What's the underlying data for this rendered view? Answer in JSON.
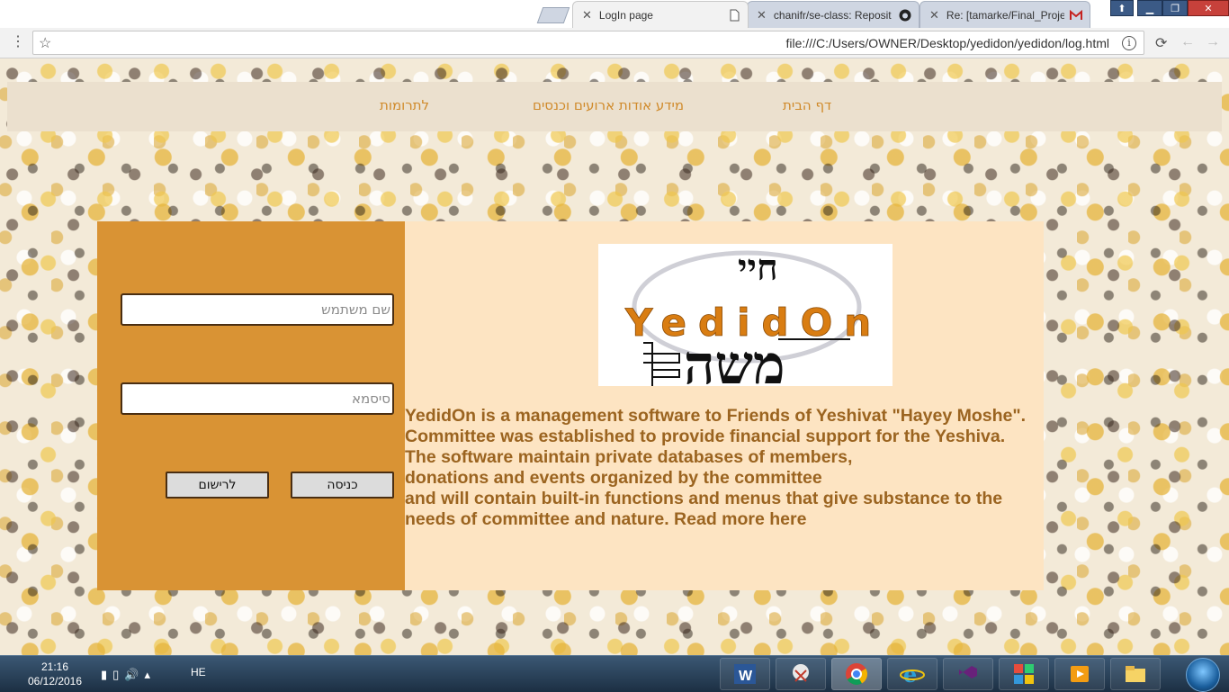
{
  "browser": {
    "tabs": [
      {
        "label": "LogIn page",
        "active": true
      },
      {
        "label": "chanifr/se-class: Reposit",
        "active": false
      },
      {
        "label": "Re: [tamarke/Final_Proje",
        "active": false
      }
    ],
    "url": "file:///C:/Users/OWNER/Desktop/yedidon/yedidon/log.html"
  },
  "nav": {
    "home": "דף הבית",
    "events": "מידע אודות ארועים וכנסים",
    "donations": "לתרומות"
  },
  "login": {
    "username_placeholder": "שם משתמש",
    "password_placeholder": "סיסמא",
    "login_label": "כניסה",
    "register_label": "לרישום"
  },
  "logo": {
    "name": "YedidOn",
    "hebrew_top": "חיי",
    "hebrew_bottom": "משה"
  },
  "description": [
    "YedidOn is a management software to Friends of Yeshivat \"Hayey Moshe\".",
    "Committee was established to provide financial support for the Yeshiva.",
    "The software maintain private databases of members,",
    "donations and events organized by the committee",
    "and will contain built-in functions and menus that give substance to the",
    "needs of committee and nature. Read more here"
  ],
  "taskbar": {
    "time": "21:16",
    "date": "06/12/2016",
    "language": "HE"
  },
  "colors": {
    "nav_bg": "#ebe0ce",
    "nav_link": "#d08a2a",
    "login_panel": "#d99334",
    "info_panel": "#fde4c2",
    "desc_text": "#9b6420"
  }
}
